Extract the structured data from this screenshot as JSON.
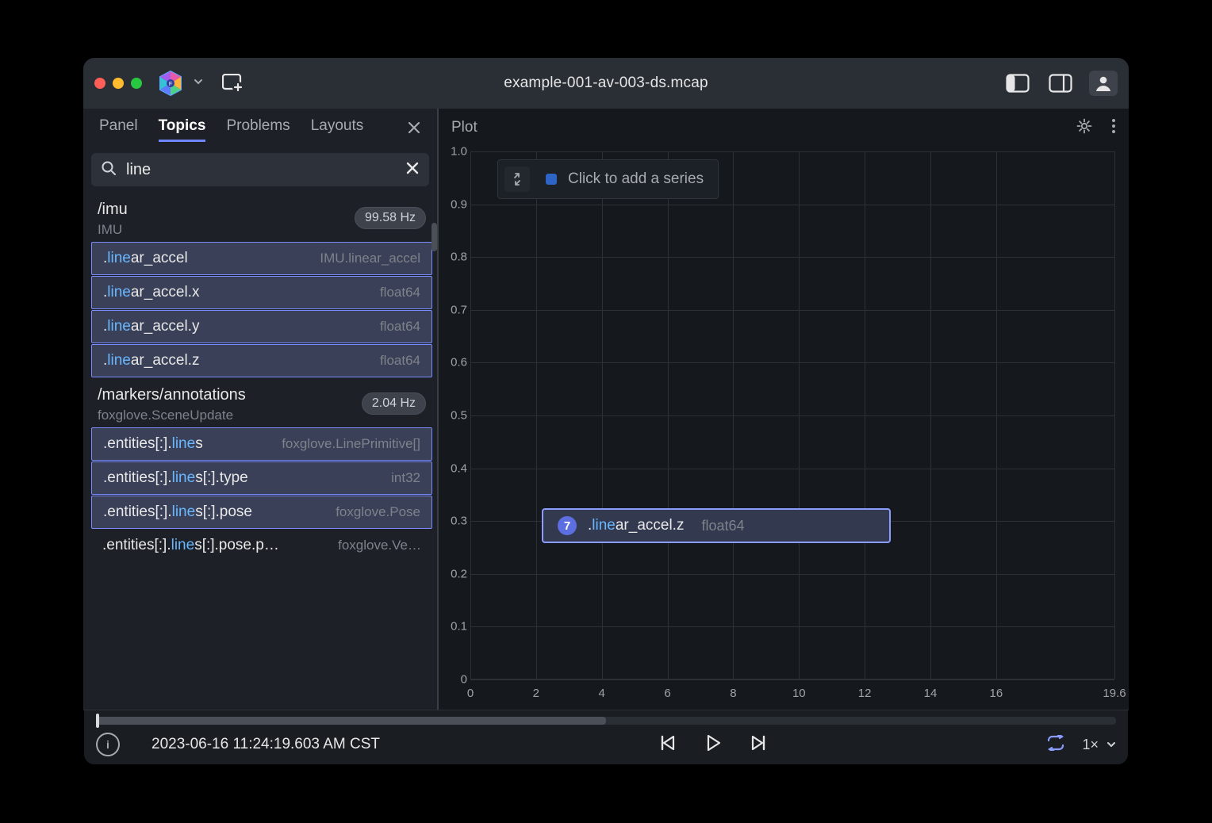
{
  "window_title": "example-001-av-003-ds.mcap",
  "tabs": [
    "Panel",
    "Topics",
    "Problems",
    "Layouts"
  ],
  "active_tab": "Topics",
  "search": {
    "value": "line",
    "placeholder": ""
  },
  "topic_groups": [
    {
      "name": "/imu",
      "subtype": "IMU",
      "rate": "99.58 Hz",
      "items": [
        {
          "path": ".linear_accel",
          "highlight": "line",
          "suffix": "ar_accel",
          "type": "IMU.linear_accel"
        },
        {
          "path": ".linear_accel.x",
          "highlight": "line",
          "suffix": "ar_accel.x",
          "type": "float64"
        },
        {
          "path": ".linear_accel.y",
          "highlight": "line",
          "suffix": "ar_accel.y",
          "type": "float64"
        },
        {
          "path": ".linear_accel.z",
          "highlight": "line",
          "suffix": "ar_accel.z",
          "type": "float64"
        }
      ]
    },
    {
      "name": "/markers/annotations",
      "subtype": "foxglove.SceneUpdate",
      "rate": "2.04 Hz",
      "items": [
        {
          "path": ".entities[:].lines",
          "pre": ".entities[:].",
          "highlight": "line",
          "suffix": "s",
          "type": "foxglove.LinePrimitive[]"
        },
        {
          "path": ".entities[:].lines[:].type",
          "pre": ".entities[:].",
          "highlight": "line",
          "suffix": "s[:].type",
          "type": "int32"
        },
        {
          "path": ".entities[:].lines[:].pose",
          "pre": ".entities[:].",
          "highlight": "line",
          "suffix": "s[:].pose",
          "type": "foxglove.Pose"
        },
        {
          "path": ".entities[:].lines[:].pose.p…",
          "pre": ".entities[:].",
          "highlight": "line",
          "suffix": "s[:].pose.p…",
          "type": "foxglove.Ve…"
        }
      ]
    }
  ],
  "plot": {
    "title": "Plot",
    "legend_text": "Click to add a series",
    "y_ticks": [
      "1.0",
      "0.9",
      "0.8",
      "0.7",
      "0.6",
      "0.5",
      "0.4",
      "0.3",
      "0.2",
      "0.1",
      "0"
    ],
    "x_ticks": [
      "0",
      "2",
      "4",
      "6",
      "8",
      "10",
      "12",
      "14",
      "16",
      "19.6"
    ],
    "drag_preview": {
      "count": "7",
      "pre": ".",
      "highlight": "line",
      "suffix": "ar_accel.z",
      "type": "float64"
    }
  },
  "footer": {
    "timestamp": "2023-06-16 11:24:19.603 AM CST",
    "speed": "1×"
  },
  "chart_data": {
    "type": "line",
    "title": "Plot",
    "series": [],
    "xlabel": "",
    "ylabel": "",
    "xlim": [
      0,
      19.6
    ],
    "ylim": [
      0,
      1.0
    ],
    "x_ticks": [
      0,
      2,
      4,
      6,
      8,
      10,
      12,
      14,
      16,
      19.6
    ],
    "y_ticks": [
      0,
      0.1,
      0.2,
      0.3,
      0.4,
      0.5,
      0.6,
      0.7,
      0.8,
      0.9,
      1.0
    ],
    "legend": [
      "Click to add a series"
    ],
    "pending_series_drop": {
      "path": ".linear_accel.z",
      "dtype": "float64",
      "count_in_drag_group": 7
    }
  }
}
